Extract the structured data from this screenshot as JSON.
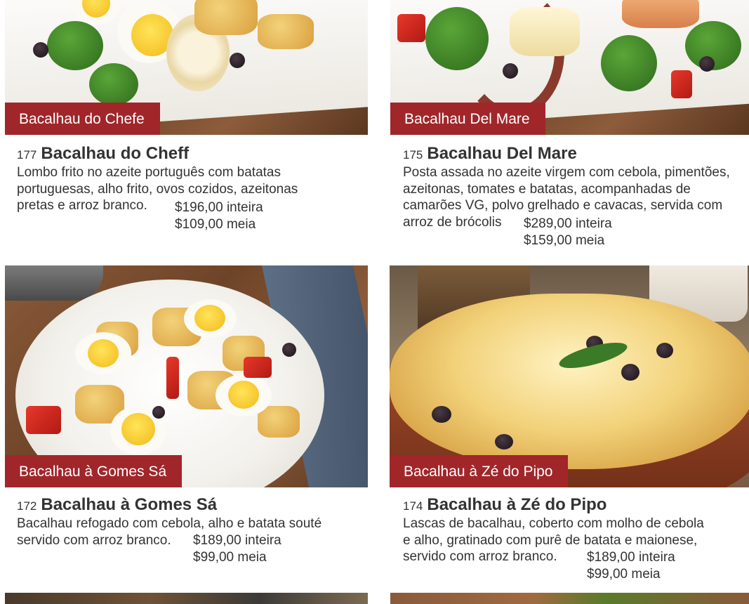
{
  "items": [
    {
      "photo_label": "Bacalhau do Chefe",
      "number": "177",
      "name": "Bacalhau do Cheff",
      "desc_lines": [
        "Lombo frito no azeite português com batatas",
        "portuguesas, alho frito, ovos cozidos, azeitonas",
        "pretas e arroz branco."
      ],
      "price_full": "$196,00 inteira",
      "price_half": "$109,00 meia"
    },
    {
      "photo_label": "Bacalhau Del Mare",
      "number": "175",
      "name": "Bacalhau Del Mare",
      "desc_lines": [
        "Posta assada no azeite virgem com cebola, pimentões,",
        "azeitonas, tomates e batatas, acompanhadas de",
        "camarões VG, polvo grelhado e cavacas, servida com",
        "arroz de brócolis"
      ],
      "price_full": "$289,00 inteira",
      "price_half": "$159,00 meia"
    },
    {
      "photo_label": "Bacalhau à Gomes Sá",
      "number": "172",
      "name": "Bacalhau à Gomes Sá",
      "desc_lines": [
        "Bacalhau refogado com cebola, alho e batata souté",
        "servido com arroz branco."
      ],
      "price_full": "$189,00 inteira",
      "price_half": "$99,00 meia"
    },
    {
      "photo_label": "Bacalhau à Zé do Pipo",
      "number": "174",
      "name": "Bacalhau à Zé do Pipo",
      "desc_lines": [
        "Lascas de bacalhau, coberto com molho de cebola",
        "e alho, gratinado com purê de batata e maionese,",
        "servido com arroz branco."
      ],
      "price_full": "$189,00 inteira",
      "price_half": "$99,00 meia"
    }
  ],
  "colors": {
    "label_bg": "#a0262a",
    "text": "#333333"
  }
}
